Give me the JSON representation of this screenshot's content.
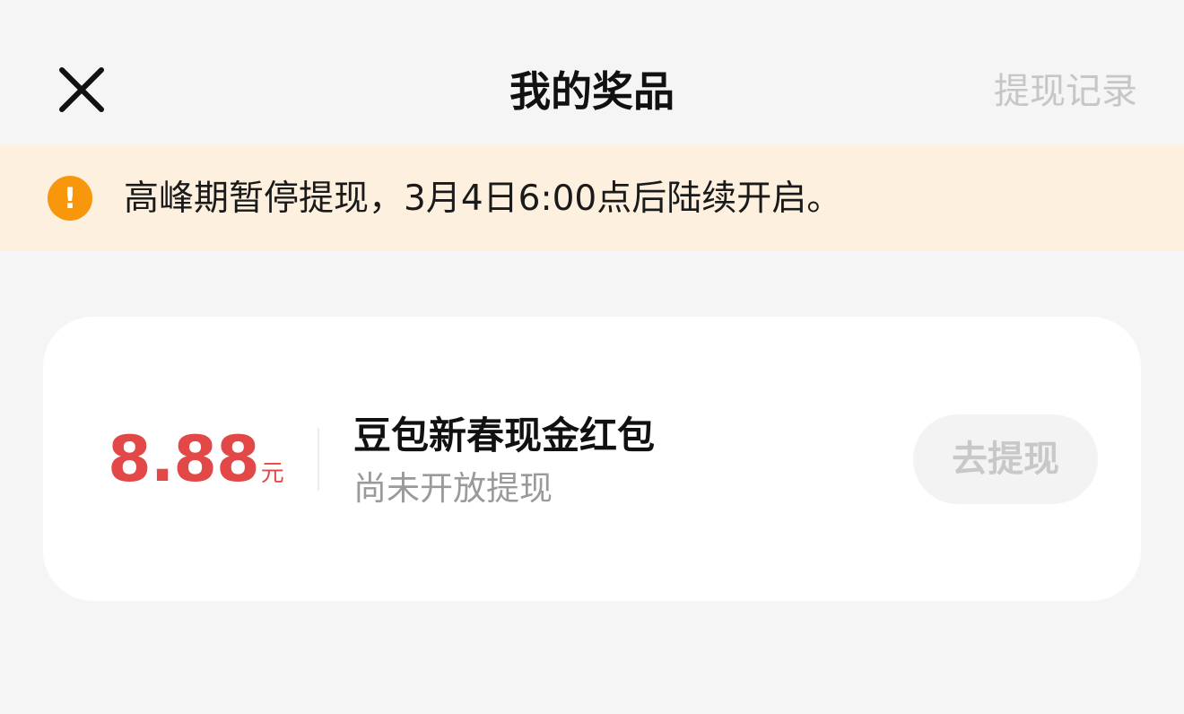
{
  "header": {
    "title": "我的奖品",
    "history_link": "提现记录",
    "close_icon": "close-icon"
  },
  "notice": {
    "icon": "warning-icon",
    "icon_glyph": "!",
    "text": "高峰期暂停提现，3月4日6:00点后陆续开启。",
    "background": "#fdf0df",
    "icon_color": "#f8960c"
  },
  "prize": {
    "amount": "8.88",
    "unit": "元",
    "title": "豆包新春现金红包",
    "status": "尚未开放提现",
    "button_label": "去提现",
    "button_enabled": false,
    "amount_color": "#e34848"
  }
}
